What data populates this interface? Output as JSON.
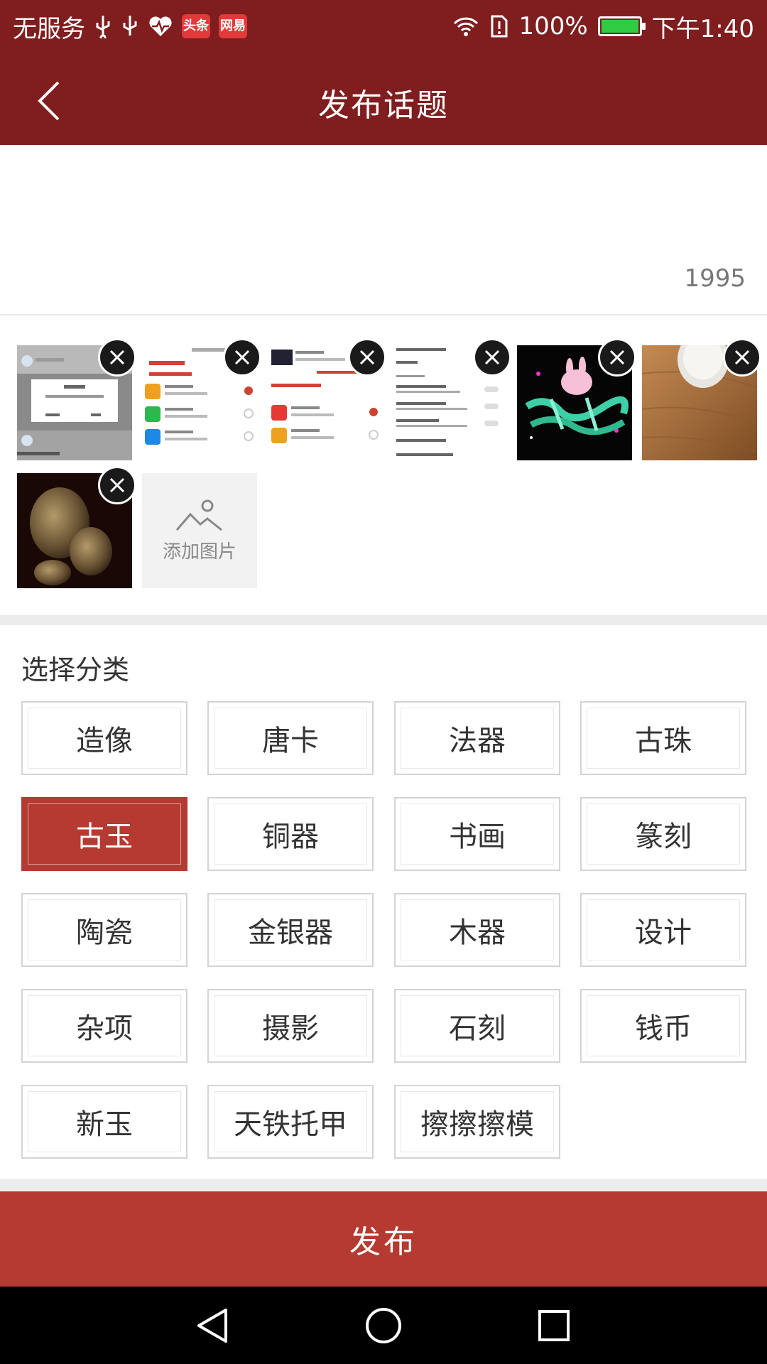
{
  "status_bar": {
    "carrier": "无服务",
    "app_badges": [
      "头条",
      "网易"
    ],
    "battery": "100%",
    "battery_level": 1.0,
    "time": "下午1:40",
    "icons": [
      "usb-icon",
      "usb-icon",
      "health-icon",
      "wifi-icon",
      "sim-alert-icon",
      "battery-icon"
    ]
  },
  "header": {
    "title": "发布话题",
    "back_icon": "chevron-left-icon"
  },
  "editor": {
    "char_count": "1995"
  },
  "images": {
    "thumbnails": [
      {
        "name": "screenshot-dialog"
      },
      {
        "name": "screenshot-payment-1"
      },
      {
        "name": "screenshot-payment-2"
      },
      {
        "name": "screenshot-settings"
      },
      {
        "name": "rabbit-sticker"
      },
      {
        "name": "wood-mouse-photo"
      },
      {
        "name": "bronze-artifact-photo"
      }
    ],
    "add_label": "添加图片"
  },
  "category": {
    "title": "选择分类",
    "items": [
      "造像",
      "唐卡",
      "法器",
      "古珠",
      "古玉",
      "铜器",
      "书画",
      "篆刻",
      "陶瓷",
      "金银器",
      "木器",
      "设计",
      "杂项",
      "摄影",
      "石刻",
      "钱币",
      "新玉",
      "天铁托甲",
      "擦擦擦模"
    ],
    "selected": "古玉"
  },
  "publish": {
    "label": "发布"
  },
  "colors": {
    "brand": "#7f1d1f",
    "accent": "#b53a31"
  },
  "nav": {
    "icons": [
      "back-triangle-icon",
      "home-circle-icon",
      "recents-square-icon"
    ]
  }
}
